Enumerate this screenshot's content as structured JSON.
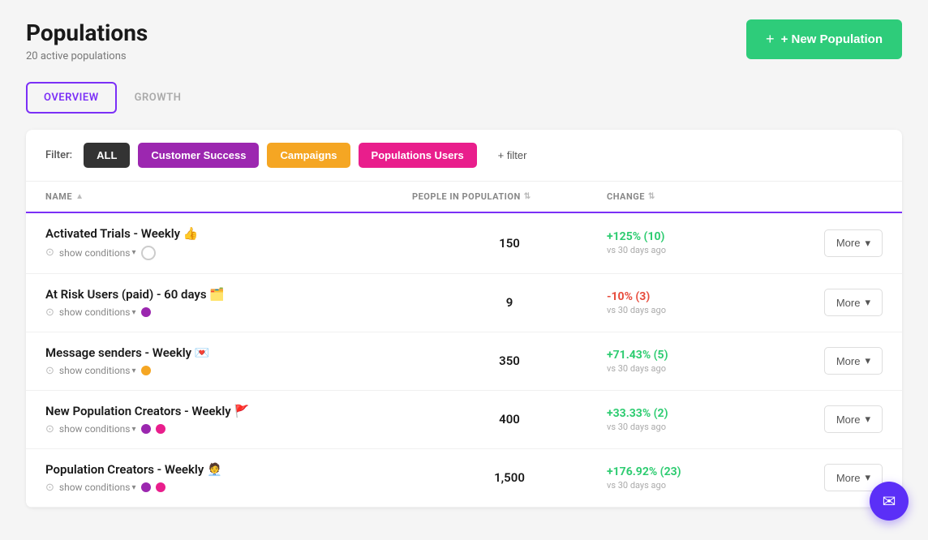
{
  "page": {
    "title": "Populations",
    "subtitle": "20 active populations"
  },
  "header": {
    "new_population_btn": "+ New Population",
    "new_population_plus": "+"
  },
  "tabs": [
    {
      "id": "overview",
      "label": "OVERVIEW",
      "active": true
    },
    {
      "id": "growth",
      "label": "GROWTH",
      "active": false
    }
  ],
  "filters": {
    "label": "Filter:",
    "buttons": [
      {
        "id": "all",
        "label": "ALL",
        "type": "all"
      },
      {
        "id": "customer-success",
        "label": "Customer Success",
        "type": "customer-success"
      },
      {
        "id": "campaigns",
        "label": "Campaigns",
        "type": "campaigns"
      },
      {
        "id": "populations-users",
        "label": "Populations Users",
        "type": "populations-users"
      },
      {
        "id": "add-filter",
        "label": "+ filter",
        "type": "add-filter"
      }
    ]
  },
  "table": {
    "columns": [
      {
        "id": "name",
        "label": "NAME"
      },
      {
        "id": "people",
        "label": "PEOPLE IN POPULATION"
      },
      {
        "id": "change",
        "label": "CHANGE"
      },
      {
        "id": "actions",
        "label": ""
      }
    ],
    "rows": [
      {
        "id": 1,
        "name": "Activated Trials - Weekly 👍",
        "show_conditions": "show conditions",
        "dots": [],
        "empty_dot": true,
        "people": "150",
        "change_value": "+125% (10)",
        "change_type": "positive",
        "change_subtitle": "vs 30 days ago",
        "action": "More"
      },
      {
        "id": 2,
        "name": "At Risk Users (paid) - 60 days 🗂️",
        "show_conditions": "show conditions",
        "dots": [
          {
            "color": "#9b27af"
          }
        ],
        "empty_dot": false,
        "people": "9",
        "change_value": "-10% (3)",
        "change_type": "negative",
        "change_subtitle": "vs 30 days ago",
        "action": "More"
      },
      {
        "id": 3,
        "name": "Message senders - Weekly 💌",
        "show_conditions": "show conditions",
        "dots": [
          {
            "color": "#f5a623"
          }
        ],
        "empty_dot": false,
        "people": "350",
        "change_value": "+71.43% (5)",
        "change_type": "positive",
        "change_subtitle": "vs 30 days ago",
        "action": "More"
      },
      {
        "id": 4,
        "name": "New Population Creators - Weekly 🚩",
        "show_conditions": "show conditions",
        "dots": [
          {
            "color": "#9b27af"
          },
          {
            "color": "#e91e8c"
          }
        ],
        "empty_dot": false,
        "people": "400",
        "change_value": "+33.33% (2)",
        "change_type": "positive",
        "change_subtitle": "vs 30 days ago",
        "action": "More"
      },
      {
        "id": 5,
        "name": "Population Creators - Weekly 🧑‍💼",
        "show_conditions": "show conditions",
        "dots": [
          {
            "color": "#9b27af"
          },
          {
            "color": "#e91e8c"
          }
        ],
        "empty_dot": false,
        "people": "1,500",
        "change_value": "+176.92% (23)",
        "change_type": "positive",
        "change_subtitle": "vs 30 days ago",
        "action": "More"
      }
    ]
  },
  "fab": {
    "icon": "✉"
  }
}
